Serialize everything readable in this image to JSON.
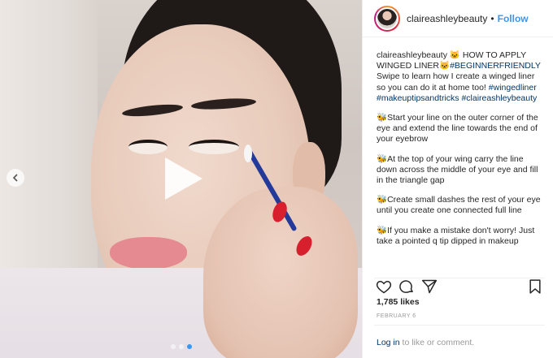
{
  "header": {
    "username": "claireashleybeauty",
    "separator": "•",
    "follow_label": "Follow"
  },
  "caption": {
    "username": "claireashleybeauty",
    "title_emoji": "🐱",
    "title": "HOW TO APPLY WINGED LINER",
    "title_emoji2": "🐱",
    "title_tag": "#BEGINNERFRIENDLY",
    "intro": "Swipe to learn how I create a winged liner so you can do it at home too!",
    "tags": "#wingedliner #makeuptipsandtricks #claireashleybeauty",
    "steps": [
      "Start your line on the outer corner of the eye and extend the line towards the end of your eyebrow",
      "At the top of your wing carry the line down across the middle of your eye and fill in the triangle gap",
      "Create small dashes the rest of your eye until you create one connected full line",
      "If you make a mistake don't worry! Just take a pointed q tip dipped in makeup"
    ],
    "step_emoji": "🐝"
  },
  "stats": {
    "likes": "1,785 likes",
    "date": "FEBRUARY 6"
  },
  "footer": {
    "login_link": "Log in",
    "login_text": " to like or comment."
  },
  "icons": {
    "like": "heart-icon",
    "comment": "comment-icon",
    "share": "share-icon",
    "save": "bookmark-icon",
    "play": "play-icon",
    "prev": "chevron-left-icon"
  },
  "colors": {
    "accent": "#3897f0",
    "link": "#003569",
    "muted": "#999999"
  },
  "carousel": {
    "total": 3,
    "active_index": 2
  }
}
